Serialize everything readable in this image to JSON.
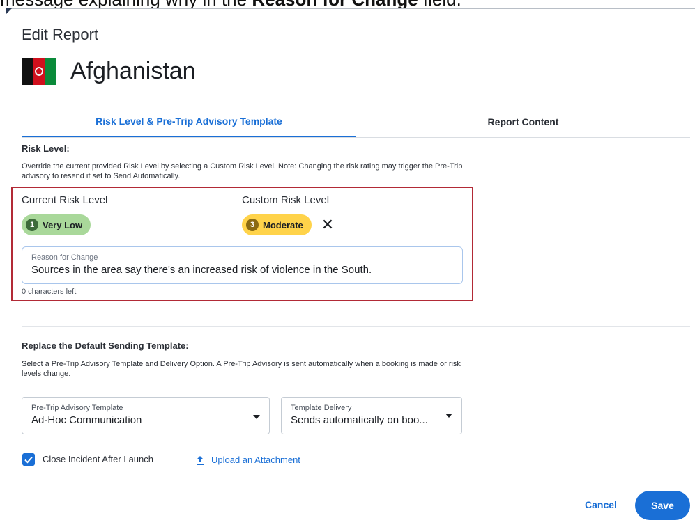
{
  "caption": {
    "prefix": "message explaining why in the ",
    "bold": "Reason for Change",
    "suffix": " field."
  },
  "header": {
    "title": "Edit Report",
    "country": "Afghanistan",
    "flag_icon": "afghanistan-flag-icon"
  },
  "tabs": [
    {
      "label": "Risk Level & Pre-Trip Advisory Template",
      "active": true
    },
    {
      "label": "Report Content",
      "active": false
    }
  ],
  "risk_section": {
    "title": "Risk Level:",
    "description": "Override the current provided Risk Level by selecting a Custom Risk Level. Note: Changing the risk rating may trigger the Pre-Trip advisory to resend if set to Send Automatically.",
    "current_label": "Current Risk Level",
    "custom_label": "Custom Risk Level",
    "current_level": {
      "number": "1",
      "label": "Very Low",
      "color": "#a9d89a"
    },
    "custom_level": {
      "number": "3",
      "label": "Moderate",
      "color": "#ffd34a"
    },
    "clear_glyph": "✕",
    "reason": {
      "label": "Reason for Change",
      "value": "Sources in the area say there's an increased risk of violence in the South."
    },
    "chars_left": "0 characters left"
  },
  "template_section": {
    "title": "Replace the Default Sending Template:",
    "description": "Select a Pre-Trip Advisory Template and Delivery Option. A Pre-Trip Advisory is sent automatically when a booking is made or risk levels change.",
    "template_select": {
      "label": "Pre-Trip Advisory Template",
      "value": "Ad-Hoc Communication"
    },
    "delivery_select": {
      "label": "Template Delivery",
      "value": "Sends automatically on boo..."
    }
  },
  "options": {
    "close_incident_label": "Close Incident After Launch",
    "close_incident_checked": true,
    "upload_label": "Upload an Attachment"
  },
  "footer": {
    "cancel_label": "Cancel",
    "save_label": "Save"
  },
  "colors": {
    "accent": "#1a6fd6",
    "highlight_border": "#b22a36"
  }
}
